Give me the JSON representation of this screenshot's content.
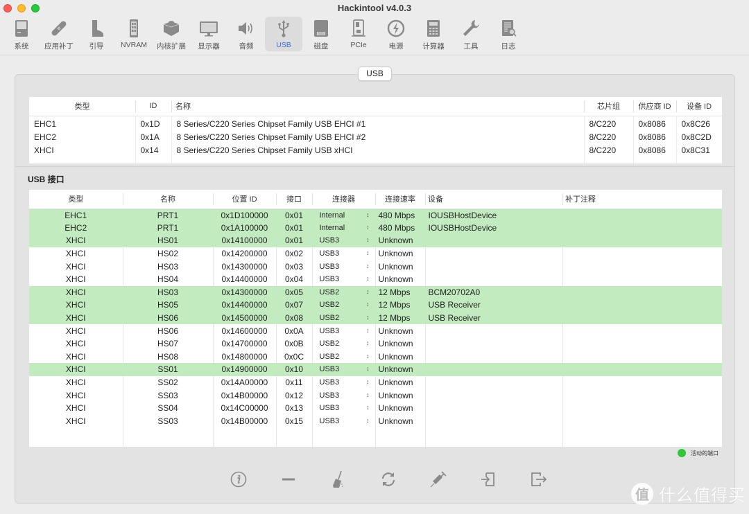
{
  "window": {
    "title": "Hackintool v4.0.3"
  },
  "toolbar": {
    "items": [
      {
        "label": "系统",
        "icon": "computer-icon"
      },
      {
        "label": "应用补丁",
        "icon": "bandage-icon"
      },
      {
        "label": "引导",
        "icon": "boot-icon"
      },
      {
        "label": "NVRAM",
        "icon": "nvram-icon"
      },
      {
        "label": "内核扩展",
        "icon": "kext-brick-icon"
      },
      {
        "label": "显示器",
        "icon": "display-icon"
      },
      {
        "label": "音频",
        "icon": "speaker-icon"
      },
      {
        "label": "USB",
        "icon": "usb-icon",
        "active": true
      },
      {
        "label": "磁盘",
        "icon": "disk-icon"
      },
      {
        "label": "PCIe",
        "icon": "pcie-icon"
      },
      {
        "label": "电源",
        "icon": "power-icon"
      },
      {
        "label": "计算器",
        "icon": "calculator-icon"
      },
      {
        "label": "工具",
        "icon": "wrench-icon"
      },
      {
        "label": "日志",
        "icon": "log-icon"
      }
    ]
  },
  "segment": {
    "label": "USB"
  },
  "controllers": {
    "headers": [
      "类型",
      "ID",
      "名称",
      "芯片组",
      "供应商 ID",
      "设备 ID"
    ],
    "rows": [
      [
        "EHC1",
        "0x1D",
        "8 Series/C220 Series Chipset Family USB EHCI #1",
        "8/C220",
        "0x8086",
        "0x8C26"
      ],
      [
        "EHC2",
        "0x1A",
        "8 Series/C220 Series Chipset Family USB EHCI #2",
        "8/C220",
        "0x8086",
        "0x8C2D"
      ],
      [
        "XHCI",
        "0x14",
        "8 Series/C220 Series Chipset Family USB xHCI",
        "8/C220",
        "0x8086",
        "0x8C31"
      ]
    ]
  },
  "ports": {
    "section_title": "USB 接口",
    "headers": [
      "类型",
      "名称",
      "位置 ID",
      "接口",
      "连接器",
      "连接速率",
      "设备",
      "补丁注释"
    ],
    "rows": [
      {
        "type": "EHC1",
        "name": "PRT1",
        "location": "0x1D100000",
        "port": "0x01",
        "connector": "Internal",
        "speed": "480 Mbps",
        "device": "IOUSBHostDevice",
        "comment": "",
        "active": true
      },
      {
        "type": "EHC2",
        "name": "PRT1",
        "location": "0x1A100000",
        "port": "0x01",
        "connector": "Internal",
        "speed": "480 Mbps",
        "device": "IOUSBHostDevice",
        "comment": "",
        "active": true
      },
      {
        "type": "XHCI",
        "name": "HS01",
        "location": "0x14100000",
        "port": "0x01",
        "connector": "USB3",
        "speed": "Unknown",
        "device": "",
        "comment": "",
        "active": true
      },
      {
        "type": "XHCI",
        "name": "HS02",
        "location": "0x14200000",
        "port": "0x02",
        "connector": "USB3",
        "speed": "Unknown",
        "device": "",
        "comment": "",
        "active": false
      },
      {
        "type": "XHCI",
        "name": "HS03",
        "location": "0x14300000",
        "port": "0x03",
        "connector": "USB3",
        "speed": "Unknown",
        "device": "",
        "comment": "",
        "active": false
      },
      {
        "type": "XHCI",
        "name": "HS04",
        "location": "0x14400000",
        "port": "0x04",
        "connector": "USB3",
        "speed": "Unknown",
        "device": "",
        "comment": "",
        "active": false
      },
      {
        "type": "XHCI",
        "name": "HS03",
        "location": "0x14300000",
        "port": "0x05",
        "connector": "USB2",
        "speed": "12 Mbps",
        "device": "BCM20702A0",
        "comment": "",
        "active": true
      },
      {
        "type": "XHCI",
        "name": "HS05",
        "location": "0x14400000",
        "port": "0x07",
        "connector": "USB2",
        "speed": "12 Mbps",
        "device": "USB Receiver",
        "comment": "",
        "active": true
      },
      {
        "type": "XHCI",
        "name": "HS06",
        "location": "0x14500000",
        "port": "0x08",
        "connector": "USB2",
        "speed": "12 Mbps",
        "device": "USB Receiver",
        "comment": "",
        "active": true
      },
      {
        "type": "XHCI",
        "name": "HS06",
        "location": "0x14600000",
        "port": "0x0A",
        "connector": "USB3",
        "speed": "Unknown",
        "device": "",
        "comment": "",
        "active": false
      },
      {
        "type": "XHCI",
        "name": "HS07",
        "location": "0x14700000",
        "port": "0x0B",
        "connector": "USB2",
        "speed": "Unknown",
        "device": "",
        "comment": "",
        "active": false
      },
      {
        "type": "XHCI",
        "name": "HS08",
        "location": "0x14800000",
        "port": "0x0C",
        "connector": "USB2",
        "speed": "Unknown",
        "device": "",
        "comment": "",
        "active": false
      },
      {
        "type": "XHCI",
        "name": "SS01",
        "location": "0x14900000",
        "port": "0x10",
        "connector": "USB3",
        "speed": "Unknown",
        "device": "",
        "comment": "",
        "active": true
      },
      {
        "type": "XHCI",
        "name": "SS02",
        "location": "0x14A00000",
        "port": "0x11",
        "connector": "USB3",
        "speed": "Unknown",
        "device": "",
        "comment": "",
        "active": false
      },
      {
        "type": "XHCI",
        "name": "SS03",
        "location": "0x14B00000",
        "port": "0x12",
        "connector": "USB3",
        "speed": "Unknown",
        "device": "",
        "comment": "",
        "active": false
      },
      {
        "type": "XHCI",
        "name": "SS04",
        "location": "0x14C00000",
        "port": "0x13",
        "connector": "USB3",
        "speed": "Unknown",
        "device": "",
        "comment": "",
        "active": false
      },
      {
        "type": "XHCI",
        "name": "SS03",
        "location": "0x14B00000",
        "port": "0x15",
        "connector": "USB3",
        "speed": "Unknown",
        "device": "",
        "comment": "",
        "active": false
      }
    ]
  },
  "legend": {
    "label": "活动的端口",
    "color": "#2fc63a"
  },
  "colors": {
    "active_row": "#c2ecc0",
    "accent": "#3a6fe0"
  },
  "bottom_tools": [
    {
      "name": "info-button",
      "icon": "info-icon"
    },
    {
      "name": "remove-button",
      "icon": "minus-icon"
    },
    {
      "name": "clear-button",
      "icon": "broom-icon"
    },
    {
      "name": "refresh-button",
      "icon": "refresh-icon"
    },
    {
      "name": "inject-button",
      "icon": "syringe-icon"
    },
    {
      "name": "import-button",
      "icon": "import-icon"
    },
    {
      "name": "export-button",
      "icon": "export-icon"
    }
  ],
  "watermark": {
    "badge": "值",
    "text": "什么值得买"
  }
}
